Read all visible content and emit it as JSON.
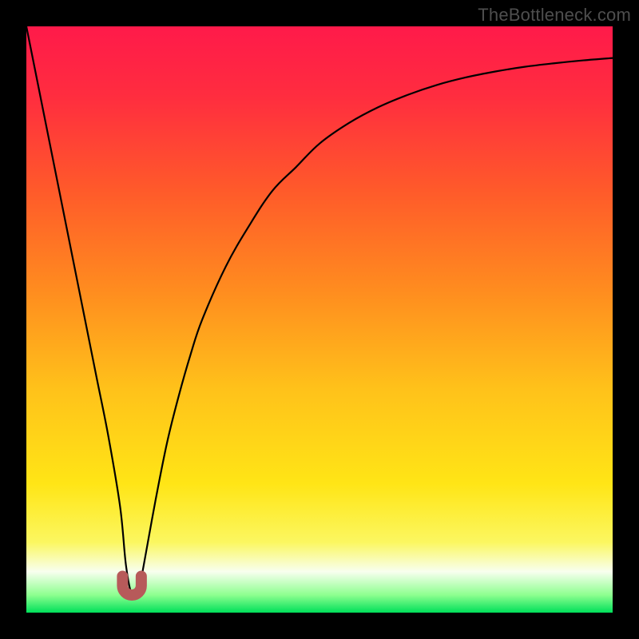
{
  "watermark": "TheBottleneck.com",
  "gradient": {
    "stops": [
      {
        "offset": 0.0,
        "color": "#ff1a4a"
      },
      {
        "offset": 0.12,
        "color": "#ff2d3f"
      },
      {
        "offset": 0.28,
        "color": "#ff5a2a"
      },
      {
        "offset": 0.45,
        "color": "#ff8c1f"
      },
      {
        "offset": 0.62,
        "color": "#ffc21a"
      },
      {
        "offset": 0.78,
        "color": "#ffe516"
      },
      {
        "offset": 0.88,
        "color": "#fbf760"
      },
      {
        "offset": 0.93,
        "color": "#f8ffef"
      },
      {
        "offset": 0.97,
        "color": "#8dff8f"
      },
      {
        "offset": 1.0,
        "color": "#00e05a"
      }
    ]
  },
  "chart_data": {
    "type": "line",
    "title": "",
    "xlabel": "",
    "ylabel": "",
    "xlim": [
      0,
      100
    ],
    "ylim": [
      0,
      100
    ],
    "series": [
      {
        "name": "curve",
        "x": [
          0,
          2,
          4,
          6,
          8,
          10,
          12,
          14,
          16,
          17,
          18,
          19,
          20,
          22,
          24,
          26,
          28,
          30,
          34,
          38,
          42,
          46,
          50,
          55,
          60,
          65,
          70,
          75,
          80,
          85,
          90,
          95,
          100
        ],
        "y": [
          100,
          90,
          80,
          70,
          60,
          50,
          40,
          30,
          18,
          8,
          3,
          3,
          8,
          19,
          29,
          37,
          44,
          50,
          59,
          66,
          72,
          76,
          80,
          83.5,
          86.2,
          88.3,
          90,
          91.3,
          92.3,
          93.1,
          93.7,
          94.2,
          94.6
        ]
      }
    ],
    "marker": {
      "shape": "u",
      "x_center": 18,
      "y": 3,
      "width_pct": 3.2,
      "height_pct": 3.2,
      "color": "#b75a5a"
    }
  }
}
